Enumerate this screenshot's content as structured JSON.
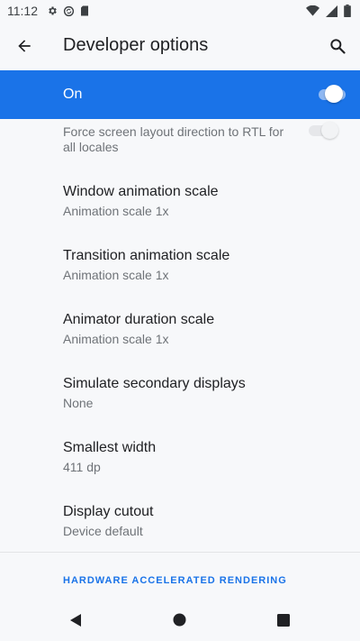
{
  "status_bar": {
    "time": "11:12",
    "left_icons": [
      "gear-icon",
      "sync-icon",
      "sd-card-icon"
    ],
    "right_icons": [
      "wifi-icon",
      "cellular-icon",
      "battery-icon"
    ]
  },
  "app_bar": {
    "title": "Developer options",
    "back_icon": "arrow-back-icon",
    "search_icon": "search-icon"
  },
  "master_switch": {
    "label": "On",
    "state": "on",
    "accent": "#1a73e8"
  },
  "partial_item": {
    "summary": "Force screen layout direction to RTL for all locales",
    "toggle_state": "off"
  },
  "preferences": [
    {
      "title": "Window animation scale",
      "summary": "Animation scale 1x"
    },
    {
      "title": "Transition animation scale",
      "summary": "Animation scale 1x"
    },
    {
      "title": "Animator duration scale",
      "summary": "Animation scale 1x"
    },
    {
      "title": "Simulate secondary displays",
      "summary": "None"
    },
    {
      "title": "Smallest width",
      "summary": "411 dp"
    },
    {
      "title": "Display cutout",
      "summary": "Device default"
    }
  ],
  "category_header": "HARDWARE ACCELERATED RENDERING",
  "nav_bar": {
    "icons": [
      "nav-back-icon",
      "nav-home-icon",
      "nav-recents-icon"
    ]
  }
}
